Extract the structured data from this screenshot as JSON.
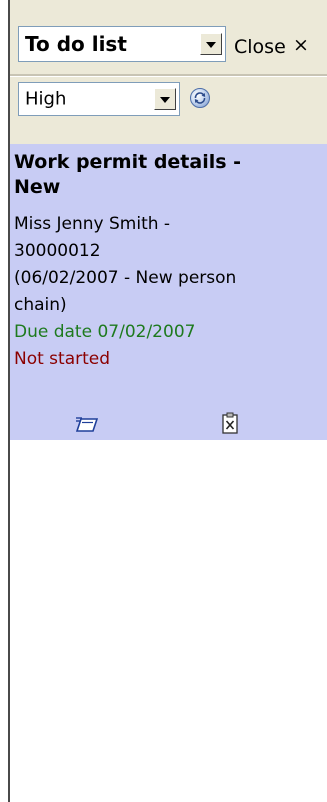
{
  "toolbar": {
    "list_select": {
      "value": "To do list"
    },
    "close_label": "Close",
    "close_glyph": "×",
    "priority_select": {
      "value": "High"
    },
    "refresh_icon": "refresh-icon"
  },
  "task": {
    "title_line1": "Work permit details -",
    "title_line2": "New",
    "person_line1": "Miss Jenny Smith -",
    "person_line2": "30000012",
    "detail_line1": "(06/02/2007 - New person",
    "detail_line2": "chain)",
    "due": "Due date 07/02/2007",
    "status": "Not started",
    "colors": {
      "due": "#1e7a1e",
      "status": "#8b0000",
      "card_bg": "#c8ccf4"
    },
    "icons": [
      "open-task-icon",
      "clipboard-close-icon"
    ]
  }
}
